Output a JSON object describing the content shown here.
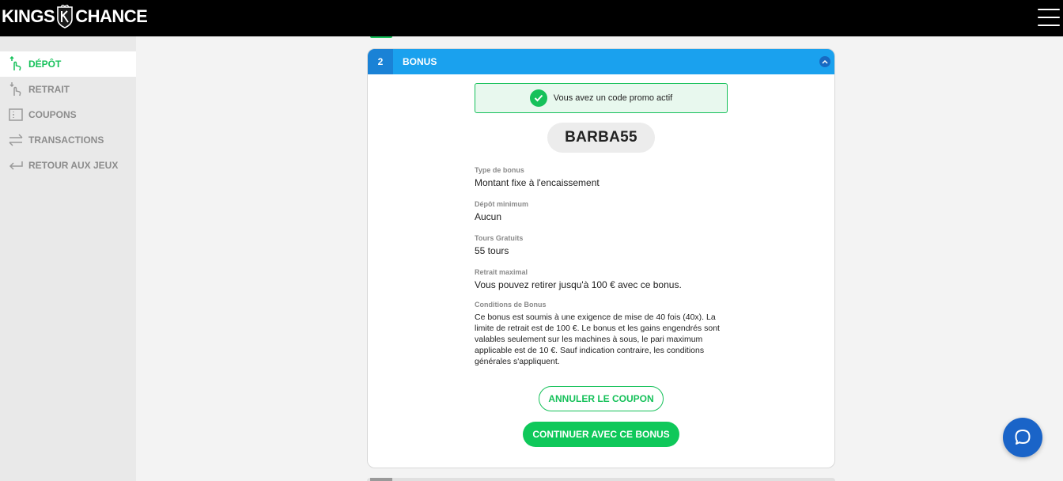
{
  "header": {
    "logo_left": "KINGS",
    "logo_right": "CHANCE",
    "menu_icon": "hamburger-icon"
  },
  "sidebar": {
    "items": [
      {
        "label": "DÉPÔT",
        "icon": "deposit-hand-icon",
        "active": true
      },
      {
        "label": "RETRAIT",
        "icon": "withdraw-hand-icon",
        "active": false
      },
      {
        "label": "COUPONS",
        "icon": "coupon-ticket-icon",
        "active": false
      },
      {
        "label": "TRANSACTIONS",
        "icon": "transfer-arrows-icon",
        "active": false
      },
      {
        "label": "RETOUR AUX JEUX",
        "icon": "return-arrow-icon",
        "active": false
      }
    ]
  },
  "bonus_card": {
    "step_number": "2",
    "title": "BONUS",
    "collapse_icon": "chevron-up-icon",
    "promo_message": "Vous avez un code promo actif",
    "promo_code": "BARBA55",
    "fields": [
      {
        "label": "Type de bonus",
        "value": "Montant fixe à l'encaissement"
      },
      {
        "label": "Dépôt minimum",
        "value": "Aucun"
      },
      {
        "label": "Tours Gratuits",
        "value": "55 tours"
      },
      {
        "label": "Retrait maximal",
        "value": "Vous pouvez retirer jusqu'à 100 € avec ce bonus."
      }
    ],
    "conditions_label": "Conditions de Bonus",
    "conditions_text": "Ce bonus est soumis à une exigence de mise de 40 fois (40x). La limite de retrait est de 100 €. Le bonus et les gains engendrés sont valables seulement sur les machines à sous, le pari maximum applicable est de 10 €. Sauf indication contraire, les conditions générales s'appliquent.",
    "cancel_button": "ANNULER LE COUPON",
    "continue_button": "CONTINUER AVEC CE BONUS"
  },
  "colors": {
    "accent_green": "#16c15a",
    "header_blue": "#1aa1ee",
    "chat_blue": "#1a64c8"
  },
  "chat": {
    "icon": "chat-bubble-icon"
  }
}
